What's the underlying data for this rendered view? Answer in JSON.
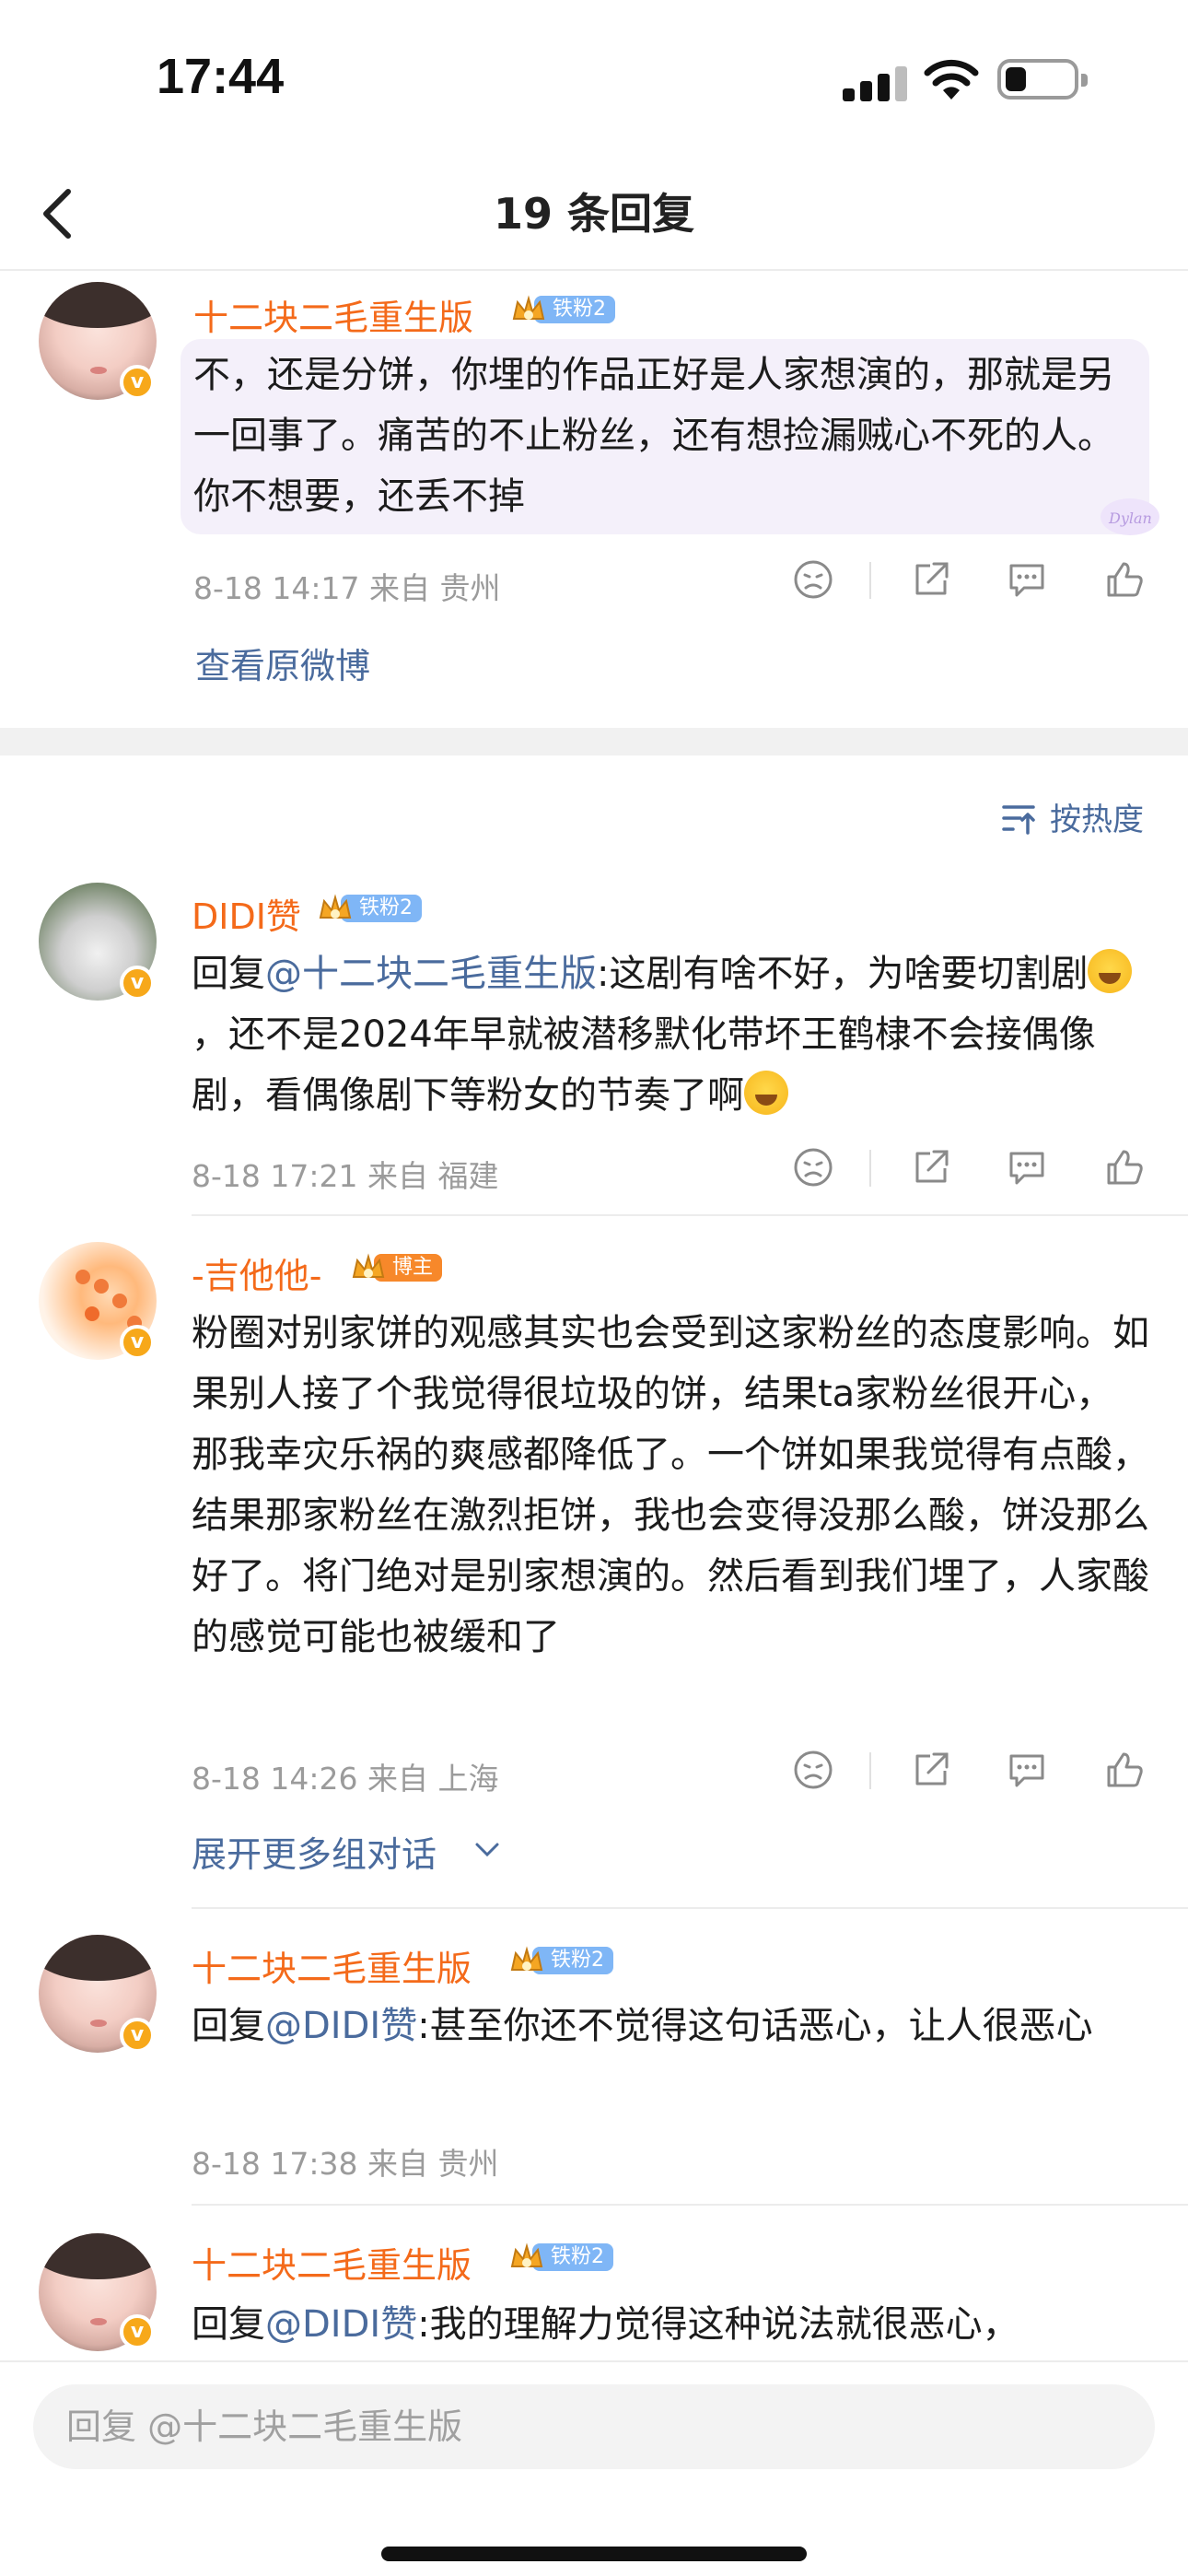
{
  "status": {
    "time": "17:44"
  },
  "nav": {
    "title": "19 条回复"
  },
  "root": {
    "user": "十二块二毛重生版",
    "badge": "铁粉2",
    "text": "不，还是分饼，你埋的作品正好是人家想演的，那就是另一回事了。痛苦的不止粉丝，还有想捡漏贼心不死的人。你不想要，还丢不掉",
    "meta": "8-18 14:17  来自 贵州",
    "view_original": "查看原微博"
  },
  "sort_label": "按热度",
  "replies": [
    {
      "user": "DIDI赞",
      "badge": "铁粉2",
      "prefix": "回复",
      "mention": "@十二块二毛重生版",
      "text_a": ":这剧有啥不好，为啥要切割剧",
      "text_b": "，还不是2024年早就被潜移默化带坏王鹤棣不会接偶像剧，看偶像剧下等粉女的节奏了啊",
      "meta": "8-18 17:21  来自 福建"
    },
    {
      "user": "-吉他他-",
      "badge": "博主",
      "text": "粉圈对别家饼的观感其实也会受到这家粉丝的态度影响。如果别人接了个我觉得很垃圾的饼，结果ta家粉丝很开心，那我幸灾乐祸的爽感都降低了。一个饼如果我觉得有点酸，结果那家粉丝在激烈拒饼，我也会变得没那么酸，饼没那么好了。将门绝对是别家想演的。然后看到我们埋了，人家酸的感觉可能也被缓和了",
      "meta": "8-18 14:26  来自 上海",
      "expand": "展开更多组对话"
    },
    {
      "user": "十二块二毛重生版",
      "badge": "铁粉2",
      "prefix": "回复",
      "mention": "@DIDI赞",
      "text": ":甚至你还不觉得这句话恶心，让人很恶心",
      "meta": "8-18 17:38  来自 贵州"
    },
    {
      "user": "十二块二毛重生版",
      "badge": "铁粉2",
      "prefix": "回复",
      "mention": "@DIDI赞",
      "text": ":我的理解力觉得这种说法就很恶心，"
    }
  ],
  "reply_box": {
    "placeholder": "回复 @十二块二毛重生版"
  },
  "icons": {
    "back": "chevron-left-icon",
    "signal": "signal-icon",
    "wifi": "wifi-icon",
    "battery": "battery-icon",
    "dislike": "dislike-face-icon",
    "share": "share-icon",
    "comment": "comment-icon",
    "like": "thumbs-up-icon",
    "sort": "sort-icon",
    "verified": "verified-badge-icon",
    "expand": "chevron-down-icon"
  },
  "colors": {
    "username": "#f46a1a",
    "link": "#4a6b9d",
    "badge_fan": "#7fb6f6",
    "badge_blogger": "#f7882a"
  }
}
